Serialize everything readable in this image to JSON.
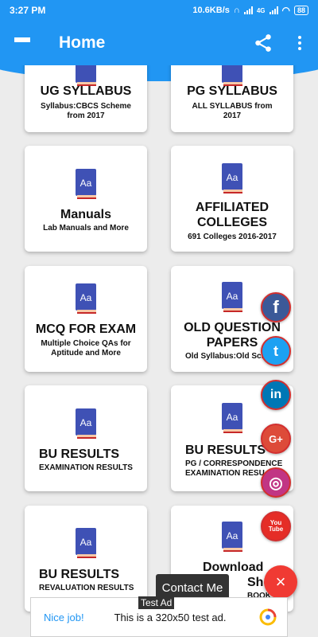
{
  "status_bar": {
    "time": "3:27 PM",
    "speed": "10.6KB/s",
    "network": "4G",
    "battery": "88"
  },
  "app_bar": {
    "title": "Home"
  },
  "cards": [
    {
      "title": "UG SYLLABUS",
      "subtitle_lines": [
        "Syllabus:CBCS Scheme",
        "from 2017"
      ]
    },
    {
      "title": "PG SYLLABUS",
      "subtitle_lines": [
        "ALL SYLLABUS from",
        "2017"
      ]
    },
    {
      "title": "Manuals",
      "subtitle_lines": [
        "Lab Manuals and More"
      ]
    },
    {
      "title_lines": [
        "AFFILIATED",
        "COLLEGES"
      ],
      "subtitle_lines": [
        "691 Colleges 2016-2017"
      ]
    },
    {
      "title": "MCQ FOR EXAM",
      "subtitle_lines": [
        "Multiple Choice QAs for",
        "Aptitude and More"
      ]
    },
    {
      "title_lines": [
        "OLD QUESTION",
        "PAPERS"
      ],
      "subtitle_lines": [
        "Old Syllabus:Old Sche"
      ]
    },
    {
      "title": "BU RESULTS",
      "subtitle_lines": [
        "EXAMINATION RESULTS"
      ]
    },
    {
      "title": "BU RESULTS",
      "subtitle_lines": [
        "PG / CORRESPONDENCE",
        "EXAMINATION RESU"
      ]
    },
    {
      "title": "BU RESULTS",
      "subtitle_lines": [
        "REVALUATION RESULTS"
      ]
    },
    {
      "title_lines": [
        "Download",
        "Sho"
      ],
      "subtitle_lines": [
        "BOOK"
      ]
    }
  ],
  "social": [
    {
      "name": "facebook",
      "glyph": "f",
      "color": "#3b5998"
    },
    {
      "name": "twitter",
      "glyph": "t",
      "color": "#1da1f2"
    },
    {
      "name": "linkedin",
      "glyph": "in",
      "color": "#0077b5"
    },
    {
      "name": "google-plus",
      "glyph": "G+",
      "color": "#dd4b39"
    },
    {
      "name": "instagram",
      "glyph": "◎",
      "color": "#c13584"
    },
    {
      "name": "youtube",
      "glyph": "You\nTube",
      "color": "#e52d27"
    }
  ],
  "fab": {
    "tooltip": "Contact Me",
    "glyph": "×",
    "color": "#f03a33"
  },
  "ad": {
    "label": "Test Ad",
    "nice": "Nice job!",
    "text": "This is a 320x50 test ad."
  },
  "colors": {
    "primary": "#2196f3",
    "book": "#3f51b5"
  }
}
